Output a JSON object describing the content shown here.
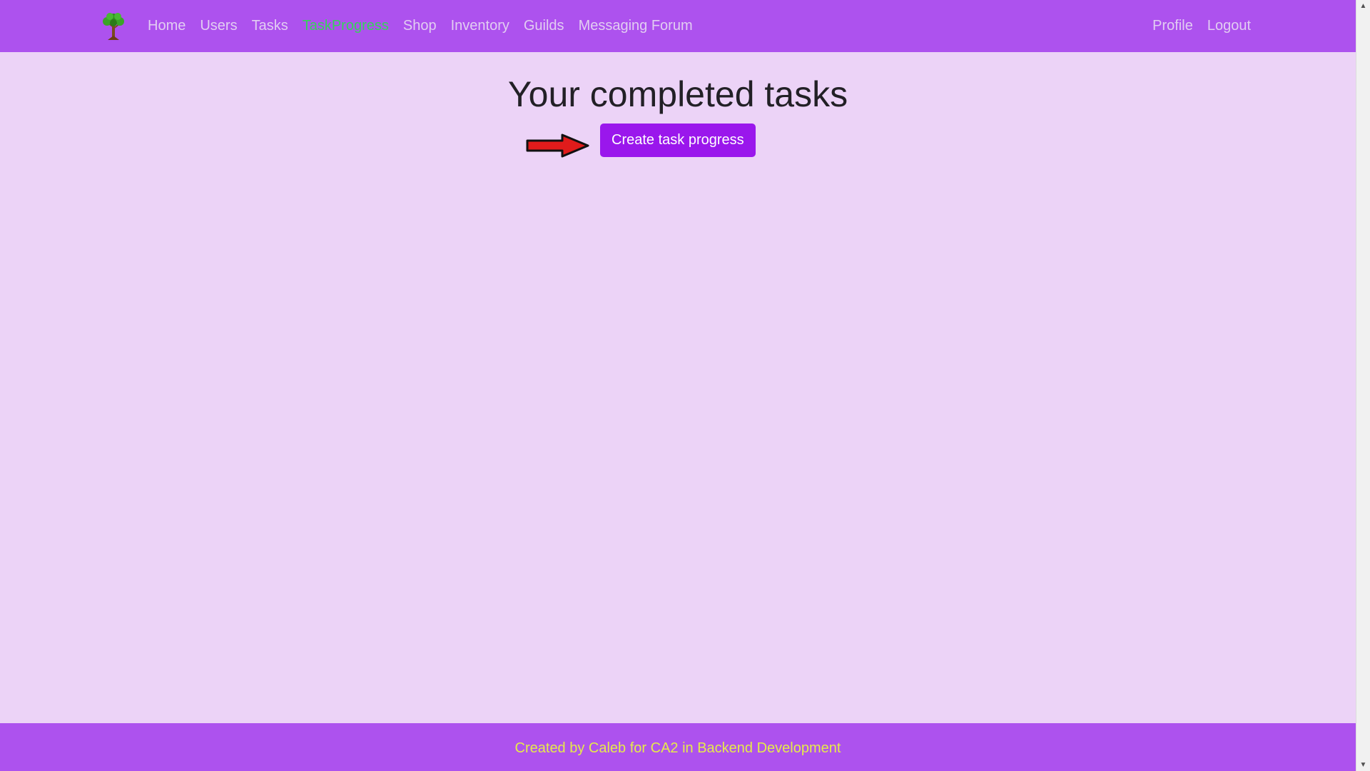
{
  "navbar": {
    "logo_icon": "tree-icon",
    "links": [
      {
        "label": "Home",
        "active": false
      },
      {
        "label": "Users",
        "active": false
      },
      {
        "label": "Tasks",
        "active": false
      },
      {
        "label": "TaskProgress",
        "active": true
      },
      {
        "label": "Shop",
        "active": false
      },
      {
        "label": "Inventory",
        "active": false
      },
      {
        "label": "Guilds",
        "active": false
      },
      {
        "label": "Messaging Forum",
        "active": false
      }
    ],
    "right_links": [
      {
        "label": "Profile"
      },
      {
        "label": "Logout"
      }
    ]
  },
  "main": {
    "title": "Your completed tasks",
    "create_button_label": "Create task progress",
    "pointer_icon": "red-arrow-icon"
  },
  "footer": {
    "text": "Created by Caleb for CA2 in Backend Development"
  },
  "colors": {
    "navbar_bg": "#ad52ee",
    "page_bg": "#ecd3f7",
    "active_link": "#35d35a",
    "button_bg": "#9a17ec",
    "footer_text": "#e6ea4a"
  }
}
